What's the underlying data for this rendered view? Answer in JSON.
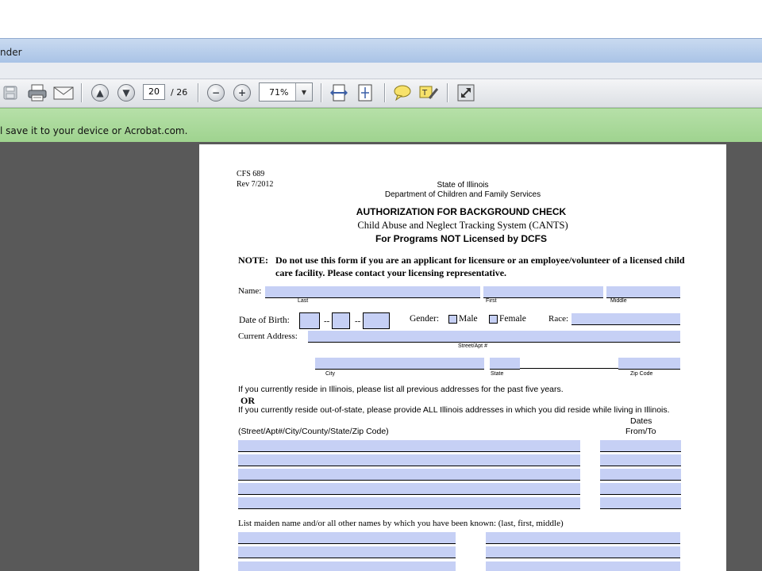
{
  "window": {
    "title_fragment": "nder"
  },
  "toolbar": {
    "page_current": "20",
    "page_total": "/ 26",
    "zoom": "71%",
    "icons": [
      "save-icon",
      "print-icon",
      "email-icon",
      "prev-page-icon",
      "next-page-icon",
      "zoom-out-icon",
      "zoom-in-icon",
      "fit-width-icon",
      "fit-page-icon",
      "comment-icon",
      "highlight-icon",
      "fullscreen-icon"
    ]
  },
  "banner": {
    "text": "l save it to your device or Acrobat.com."
  },
  "form": {
    "code": "CFS 689",
    "rev": "Rev 7/2012",
    "state": "State of Illinois",
    "dept": "Department of Children and Family Services",
    "title": "AUTHORIZATION FOR BACKGROUND CHECK",
    "subtitle": "Child Abuse and Neglect Tracking System (CANTS)",
    "subtitle2": "For Programs NOT Licensed by DCFS",
    "note_label": "NOTE:",
    "note_line1": "Do not use this form if you are an applicant for licensure or an employee/volunteer of a licensed child",
    "note_line2": "care facility. Please contact your licensing representative.",
    "name_label": "Name:",
    "cap_last": "Last",
    "cap_first": "First",
    "cap_middle": "Middle",
    "dob_label": "Date of Birth:",
    "dash": "--",
    "gender_label": "Gender:",
    "male": "Male",
    "female": "Female",
    "race_label": "Race:",
    "address_label": "Current Address:",
    "cap_street": "Street/Apt #",
    "cap_city": "City",
    "cap_state": "State",
    "cap_zip": "Zip Code",
    "reside_il": "If you currently reside in Illinois, please list all previous addresses for the past five years.",
    "or": "OR",
    "reside_out": "If you currently reside out-of-state, please provide ALL Illinois addresses in which you did reside while living in Illinois.",
    "dates": "Dates",
    "from_to": "From/To",
    "address_cols": "(Street/Apt#/City/County/State/Zip Code)",
    "maiden": "List maiden name and/or all other names by which you have been known: (last, first, middle)"
  }
}
